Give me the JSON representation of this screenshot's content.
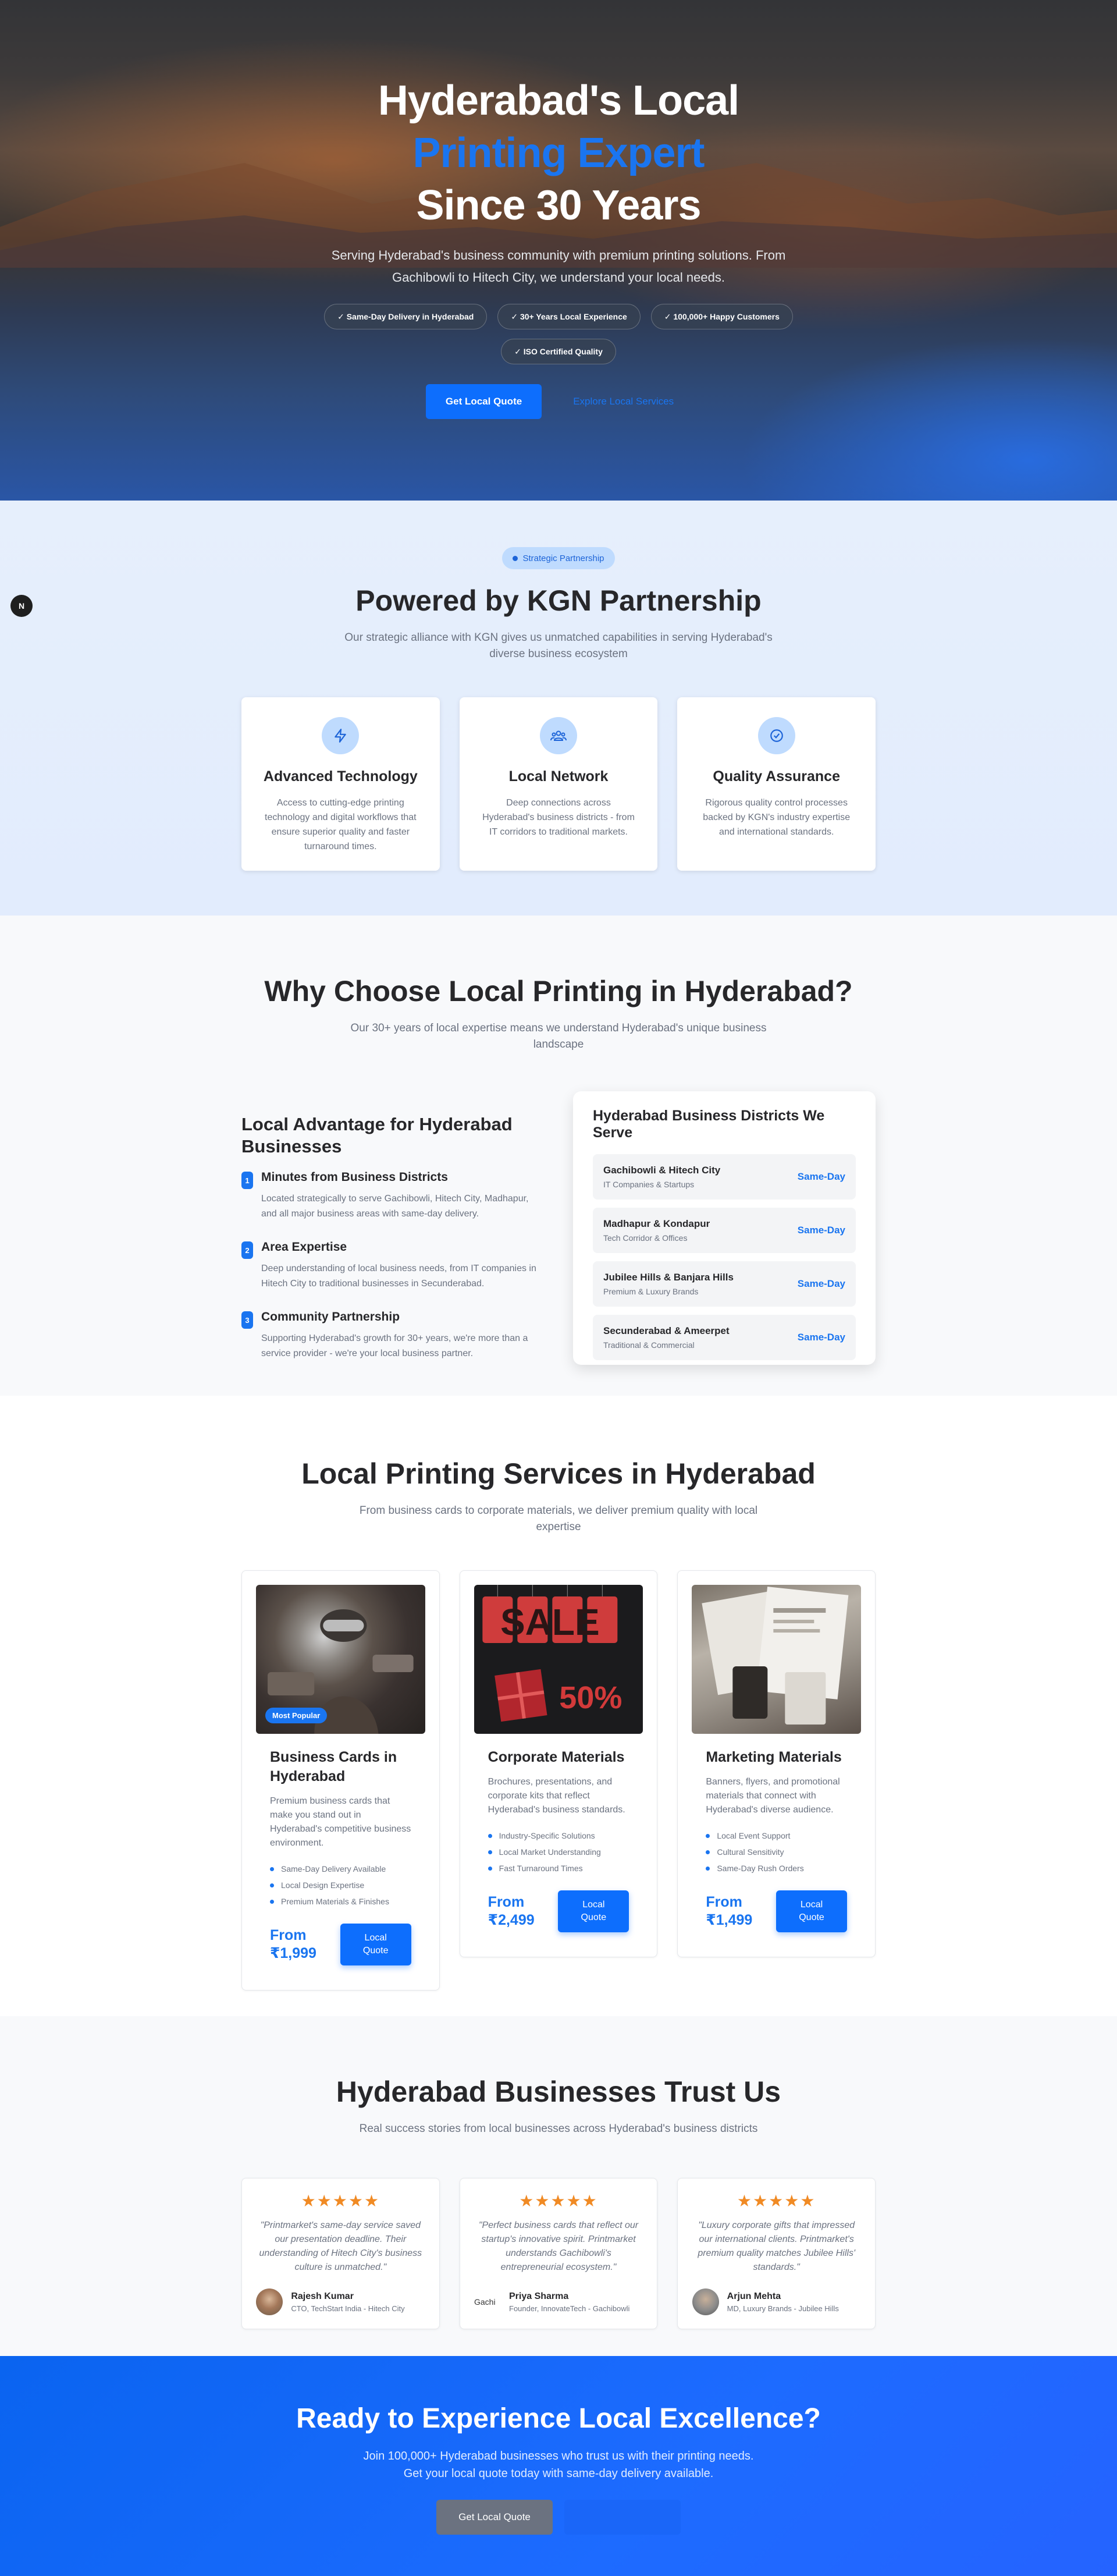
{
  "hero": {
    "title_line1": "Hyderabad's Local",
    "title_accent": "Printing Expert",
    "title_line3": "Since 30 Years",
    "lead": "Serving Hyderabad's business community with premium printing solutions. From Gachibowli to Hitech City, we understand your local needs.",
    "badges": [
      "✓ Same-Day Delivery in Hyderabad",
      "✓ 30+ Years Local Experience",
      "✓ 100,000+ Happy Customers",
      "✓ ISO Certified Quality"
    ],
    "primary_cta": "Get Local Quote",
    "secondary_cta": "Explore Local Services"
  },
  "partnership": {
    "pill": "Strategic Partnership",
    "title": "Powered by KGN Partnership",
    "subtitle": "Our strategic alliance with KGN gives us unmatched capabilities in serving Hyderabad's diverse business ecosystem",
    "features": [
      {
        "icon": "lightning-icon",
        "title": "Advanced Technology",
        "text": "Access to cutting-edge printing technology and digital workflows that ensure superior quality and faster turnaround times."
      },
      {
        "icon": "users-icon",
        "title": "Local Network",
        "text": "Deep connections across Hyderabad's business districts - from IT corridors to traditional markets."
      },
      {
        "icon": "check-circle-icon",
        "title": "Quality Assurance",
        "text": "Rigorous quality control processes backed by KGN's industry expertise and international standards."
      }
    ],
    "floating_badge": "N"
  },
  "why": {
    "title": "Why Choose Local Printing in Hyderabad?",
    "subtitle": "Our 30+ years of local expertise means we understand Hyderabad's unique business landscape",
    "left_title": "Local Advantage for Hyderabad Businesses",
    "points": [
      {
        "num": "1",
        "title": "Minutes from Business Districts",
        "text": "Located strategically to serve Gachibowli, Hitech City, Madhapur, and all major business areas with same-day delivery."
      },
      {
        "num": "2",
        "title": "Area Expertise",
        "text": "Deep understanding of local business needs, from IT companies in Hitech City to traditional businesses in Secunderabad."
      },
      {
        "num": "3",
        "title": "Community Partnership",
        "text": "Supporting Hyderabad's growth for 30+ years, we're more than a service provider - we're your local business partner."
      }
    ],
    "districts_title": "Hyderabad Business Districts We Serve",
    "districts": [
      {
        "name": "Gachibowli & Hitech City",
        "sub": "IT Companies & Startups",
        "tag": "Same-Day"
      },
      {
        "name": "Madhapur & Kondapur",
        "sub": "Tech Corridor & Offices",
        "tag": "Same-Day"
      },
      {
        "name": "Jubilee Hills & Banjara Hills",
        "sub": "Premium & Luxury Brands",
        "tag": "Same-Day"
      },
      {
        "name": "Secunderabad & Ameerpet",
        "sub": "Traditional & Commercial",
        "tag": "Same-Day"
      }
    ]
  },
  "services": {
    "title": "Local Printing Services in Hyderabad",
    "subtitle": "From business cards to corporate materials, we deliver premium quality with local expertise",
    "items": [
      {
        "badge": "Most Popular",
        "title": "Business Cards in Hyderabad",
        "desc": "Premium business cards that make you stand out in Hyderabad's competitive business environment.",
        "features": [
          "Same-Day Delivery Available",
          "Local Design Expertise",
          "Premium Materials & Finishes"
        ],
        "price_label": "From",
        "price": "₹1,999",
        "cta_line1": "Local",
        "cta_line2": "Quote"
      },
      {
        "img_text_top": "SALE",
        "img_text_bottom": "50%",
        "title": "Corporate Materials",
        "desc": "Brochures, presentations, and corporate kits that reflect Hyderabad's business standards.",
        "features": [
          "Industry-Specific Solutions",
          "Local Market Understanding",
          "Fast Turnaround Times"
        ],
        "price_label": "From",
        "price": "₹2,499",
        "cta_line1": "Local",
        "cta_line2": "Quote"
      },
      {
        "title": "Marketing Materials",
        "desc": "Banners, flyers, and promotional materials that connect with Hyderabad's diverse audience.",
        "features": [
          "Local Event Support",
          "Cultural Sensitivity",
          "Same-Day Rush Orders"
        ],
        "price_label": "From",
        "price": "₹1,499",
        "cta_line1": "Local",
        "cta_line2": "Quote"
      }
    ]
  },
  "trust": {
    "title": "Hyderabad Businesses Trust Us",
    "subtitle": "Real success stories from local businesses across Hyderabad's business districts",
    "rating": 5,
    "testimonials": [
      {
        "stars": "★★★★★",
        "quote": "\"Printmarket's same-day service saved our presentation deadline. Their understanding of Hitech City's business culture is unmatched.\"",
        "name": "Rajesh Kumar",
        "role": "CTO, TechStart India - Hitech City"
      },
      {
        "stars": "★★★★★",
        "quote": "\"Perfect business cards that reflect our startup's innovative spirit. Printmarket understands Gachibowli's entrepreneurial ecosystem.\"",
        "name": "Priya Sharma",
        "role": "Founder, InnovateTech - Gachibowli",
        "avatar_alt": "Gachi"
      },
      {
        "stars": "★★★★★",
        "quote": "\"Luxury corporate gifts that impressed our international clients. Printmarket's premium quality matches Jubilee Hills' standards.\"",
        "name": "Arjun Mehta",
        "role": "MD, Luxury Brands - Jubilee Hills"
      }
    ]
  },
  "cta": {
    "title": "Ready to Experience Local Excellence?",
    "line1": "Join 100,000+ Hyderabad businesses who trust us with their printing needs.",
    "line2": "Get your local quote today with same-day delivery available.",
    "primary": "Get Local Quote"
  },
  "colors": {
    "accent": "#1a75f0",
    "button": "#0d6efd",
    "star": "#f08a24",
    "cta_bg": "#1d6bff"
  }
}
